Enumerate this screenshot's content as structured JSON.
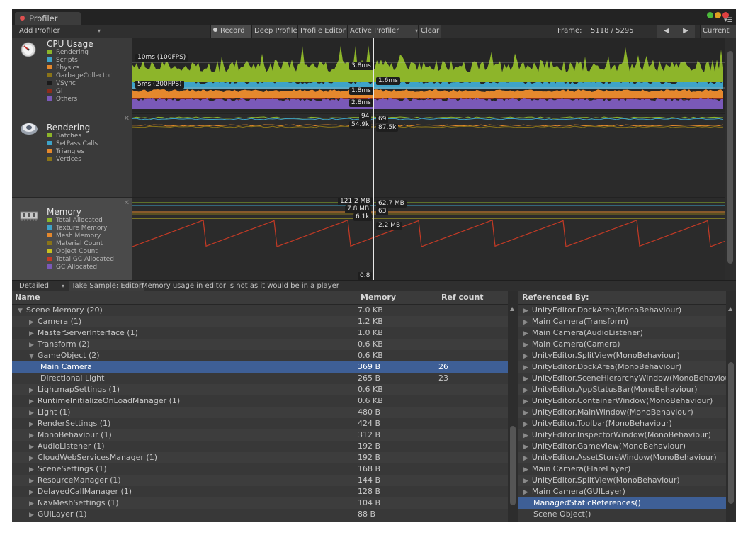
{
  "window": {
    "tab_title": "Profiler",
    "traffic_light_colors": [
      "#4cbb3c",
      "#e0a020",
      "#e04040"
    ]
  },
  "toolbar": {
    "add_profiler": "Add Profiler",
    "record": "Record",
    "deep_profile": "Deep Profile",
    "profile_editor": "Profile Editor",
    "active_profiler": "Active Profiler",
    "clear": "Clear",
    "frame_label": "Frame:",
    "frame_value": "5118 / 5295",
    "current": "Current"
  },
  "modules": {
    "cpu": {
      "title": "CPU Usage",
      "legend": [
        {
          "label": "Rendering",
          "color": "#8db52a"
        },
        {
          "label": "Scripts",
          "color": "#3ea3c8"
        },
        {
          "label": "Physics",
          "color": "#e5882d"
        },
        {
          "label": "GarbageCollector",
          "color": "#8a7418"
        },
        {
          "label": "VSync",
          "color": "#1a1a1a"
        },
        {
          "label": "Gi",
          "color": "#8d2d1c"
        },
        {
          "label": "Others",
          "color": "#7a59b8"
        }
      ],
      "labels": {
        "fps100": "10ms (100FPS)",
        "fps200": "5ms (200FPS)",
        "v1": "3.8ms",
        "v2": "1.6ms",
        "v3": "1.8ms",
        "v4": "2.8ms"
      }
    },
    "rendering": {
      "title": "Rendering",
      "legend": [
        {
          "label": "Batches",
          "color": "#8db52a"
        },
        {
          "label": "SetPass Calls",
          "color": "#3ea3c8"
        },
        {
          "label": "Triangles",
          "color": "#e5882d"
        },
        {
          "label": "Vertices",
          "color": "#8a7418"
        }
      ],
      "labels": {
        "a": "94",
        "b": "69",
        "c": "54.9k",
        "d": "87.5k"
      }
    },
    "memory": {
      "title": "Memory",
      "legend": [
        {
          "label": "Total Allocated",
          "color": "#8db52a"
        },
        {
          "label": "Texture Memory",
          "color": "#3ea3c8"
        },
        {
          "label": "Mesh Memory",
          "color": "#e5882d"
        },
        {
          "label": "Material Count",
          "color": "#8a7418"
        },
        {
          "label": "Object Count",
          "color": "#c8c020"
        },
        {
          "label": "Total GC Allocated",
          "color": "#c43a25"
        },
        {
          "label": "GC Allocated",
          "color": "#7a59b8"
        }
      ],
      "labels": {
        "a": "121.2 MB",
        "b": "62.7 MB",
        "c": "7.8 MB",
        "d": "63",
        "e": "6.1k",
        "f": "2.2 MB",
        "g": "0.8"
      }
    }
  },
  "bottom_toolbar": {
    "mode": "Detailed",
    "take_sample": "Take Sample: Editor",
    "note": "Memory usage in editor is not as it would be in a player"
  },
  "table": {
    "columns": {
      "name": "Name",
      "memory": "Memory",
      "refcount": "Ref count",
      "referenced_by": "Referenced By:"
    },
    "rows": [
      {
        "name": "Scene Memory (20)",
        "memory": "7.0 KB",
        "refs": "",
        "level": 0,
        "expander": "down"
      },
      {
        "name": "Camera (1)",
        "memory": "1.2 KB",
        "refs": "",
        "level": 1,
        "expander": "right"
      },
      {
        "name": "MasterServerInterface (1)",
        "memory": "1.0 KB",
        "refs": "",
        "level": 1,
        "expander": "right"
      },
      {
        "name": "Transform (2)",
        "memory": "0.6 KB",
        "refs": "",
        "level": 1,
        "expander": "right"
      },
      {
        "name": "GameObject (2)",
        "memory": "0.6 KB",
        "refs": "",
        "level": 1,
        "expander": "down"
      },
      {
        "name": "Main Camera",
        "memory": "369 B",
        "refs": "26",
        "level": 2,
        "expander": "none",
        "selected": true
      },
      {
        "name": "Directional Light",
        "memory": "265 B",
        "refs": "23",
        "level": 2,
        "expander": "none"
      },
      {
        "name": "LightmapSettings (1)",
        "memory": "0.6 KB",
        "refs": "",
        "level": 1,
        "expander": "right"
      },
      {
        "name": "RuntimeInitializeOnLoadManager (1)",
        "memory": "0.6 KB",
        "refs": "",
        "level": 1,
        "expander": "right"
      },
      {
        "name": "Light (1)",
        "memory": "480 B",
        "refs": "",
        "level": 1,
        "expander": "right"
      },
      {
        "name": "RenderSettings (1)",
        "memory": "424 B",
        "refs": "",
        "level": 1,
        "expander": "right"
      },
      {
        "name": "MonoBehaviour (1)",
        "memory": "312 B",
        "refs": "",
        "level": 1,
        "expander": "right"
      },
      {
        "name": "AudioListener (1)",
        "memory": "192 B",
        "refs": "",
        "level": 1,
        "expander": "right"
      },
      {
        "name": "CloudWebServicesManager (1)",
        "memory": "192 B",
        "refs": "",
        "level": 1,
        "expander": "right"
      },
      {
        "name": "SceneSettings (1)",
        "memory": "168 B",
        "refs": "",
        "level": 1,
        "expander": "right"
      },
      {
        "name": "ResourceManager (1)",
        "memory": "144 B",
        "refs": "",
        "level": 1,
        "expander": "right"
      },
      {
        "name": "DelayedCallManager (1)",
        "memory": "128 B",
        "refs": "",
        "level": 1,
        "expander": "right"
      },
      {
        "name": "NavMeshSettings (1)",
        "memory": "104 B",
        "refs": "",
        "level": 1,
        "expander": "right"
      },
      {
        "name": "GUILayer (1)",
        "memory": "88 B",
        "refs": "",
        "level": 1,
        "expander": "right"
      }
    ],
    "referenced_by": [
      {
        "name": "UnityEditor.DockArea(MonoBehaviour)",
        "expander": true
      },
      {
        "name": "Main Camera(Transform)",
        "expander": true
      },
      {
        "name": "Main Camera(AudioListener)",
        "expander": true
      },
      {
        "name": "Main Camera(Camera)",
        "expander": true
      },
      {
        "name": "UnityEditor.SplitView(MonoBehaviour)",
        "expander": true
      },
      {
        "name": "UnityEditor.DockArea(MonoBehaviour)",
        "expander": true
      },
      {
        "name": "UnityEditor.SceneHierarchyWindow(MonoBehaviour)",
        "expander": true
      },
      {
        "name": "UnityEditor.AppStatusBar(MonoBehaviour)",
        "expander": true
      },
      {
        "name": "UnityEditor.ContainerWindow(MonoBehaviour)",
        "expander": true
      },
      {
        "name": "UnityEditor.MainWindow(MonoBehaviour)",
        "expander": true
      },
      {
        "name": "UnityEditor.Toolbar(MonoBehaviour)",
        "expander": true
      },
      {
        "name": "UnityEditor.InspectorWindow(MonoBehaviour)",
        "expander": true
      },
      {
        "name": "UnityEditor.GameView(MonoBehaviour)",
        "expander": true
      },
      {
        "name": "UnityEditor.AssetStoreWindow(MonoBehaviour)",
        "expander": true
      },
      {
        "name": "Main Camera(FlareLayer)",
        "expander": true
      },
      {
        "name": "UnityEditor.SplitView(MonoBehaviour)",
        "expander": true
      },
      {
        "name": "Main Camera(GUILayer)",
        "expander": true
      },
      {
        "name": "ManagedStaticReferences()",
        "expander": false,
        "selected": true
      },
      {
        "name": "Scene Object()",
        "expander": false
      }
    ]
  }
}
